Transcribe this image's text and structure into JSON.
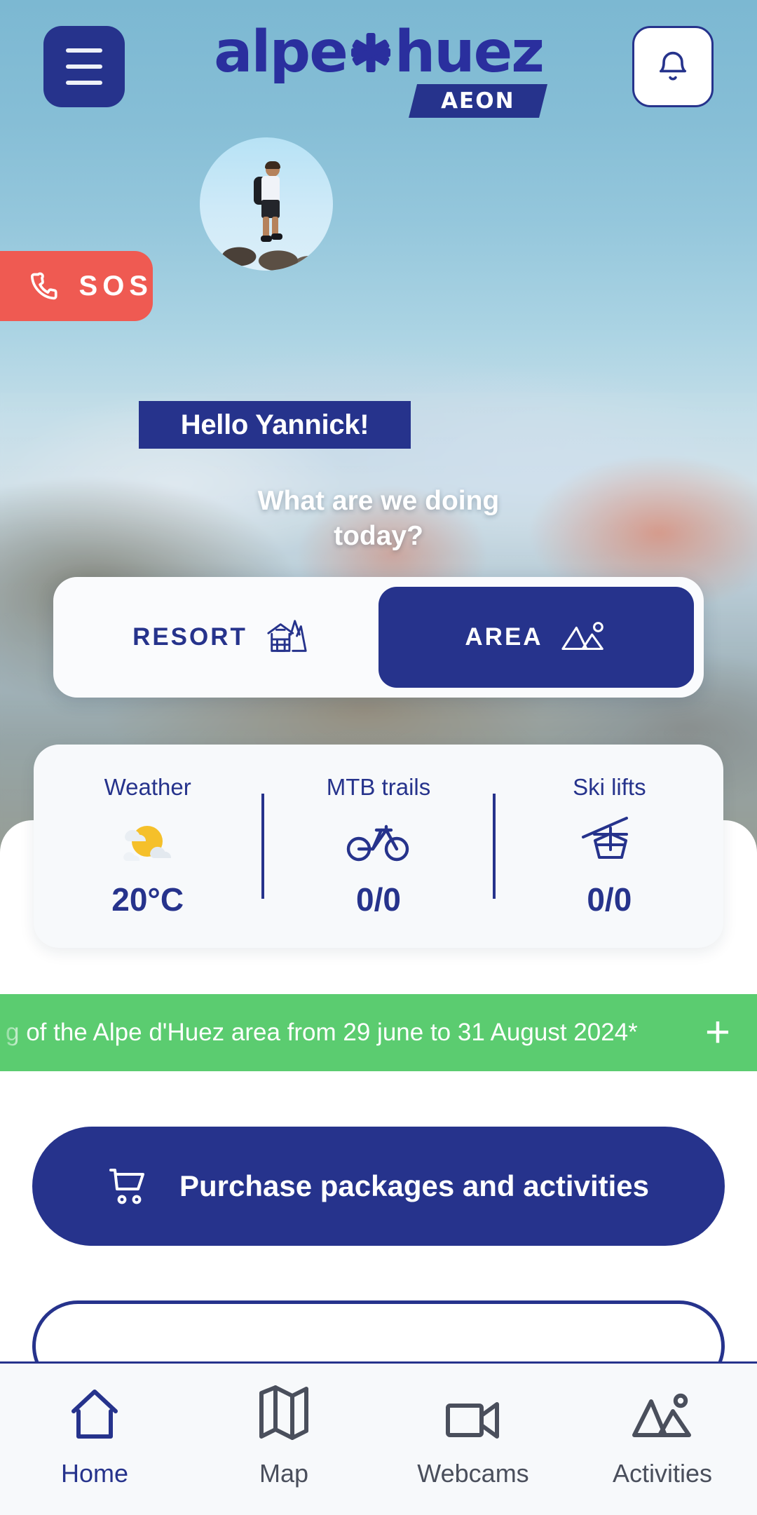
{
  "brand": {
    "logo_text": "alpe huez",
    "logo_word_1": "alpe",
    "logo_word_2": "huez",
    "logo_badge": "AEON",
    "primary_color": "#26338c",
    "accent_green": "#5bcc70",
    "accent_red": "#ef5a52"
  },
  "topbar": {
    "menu_icon": "hamburger-menu-icon",
    "notification_icon": "bell-icon"
  },
  "sos": {
    "label": "SOS",
    "icon": "phone-icon"
  },
  "profile": {
    "avatar_alt": "hiker-avatar",
    "greeting": "Hello Yannick!",
    "question_line_1": "What are we doing",
    "question_line_2": "today?",
    "question": "What are we doing today?"
  },
  "segmented": {
    "options": [
      {
        "label": "RESORT",
        "icon": "chalet-icon",
        "active": false
      },
      {
        "label": "AREA",
        "icon": "mountains-icon",
        "active": true
      }
    ]
  },
  "stats": [
    {
      "label": "Weather",
      "icon": "sun-cloud-icon",
      "value": "20°C"
    },
    {
      "label": "MTB trails",
      "icon": "bicycle-icon",
      "value": "0/0"
    },
    {
      "label": "Ski lifts",
      "icon": "gondola-icon",
      "value": "0/0"
    }
  ],
  "banner": {
    "text": "g of the Alpe d'Huez area from 29 june to 31 August 2024*",
    "expand_icon": "plus-icon"
  },
  "purchase": {
    "label": "Purchase packages and activities",
    "icon": "shopping-cart-icon"
  },
  "bottomnav": {
    "items": [
      {
        "label": "Home",
        "icon": "home-icon",
        "active": true
      },
      {
        "label": "Map",
        "icon": "map-icon",
        "active": false
      },
      {
        "label": "Webcams",
        "icon": "video-camera-icon",
        "active": false
      },
      {
        "label": "Activities",
        "icon": "mountains-icon",
        "active": false
      }
    ]
  }
}
